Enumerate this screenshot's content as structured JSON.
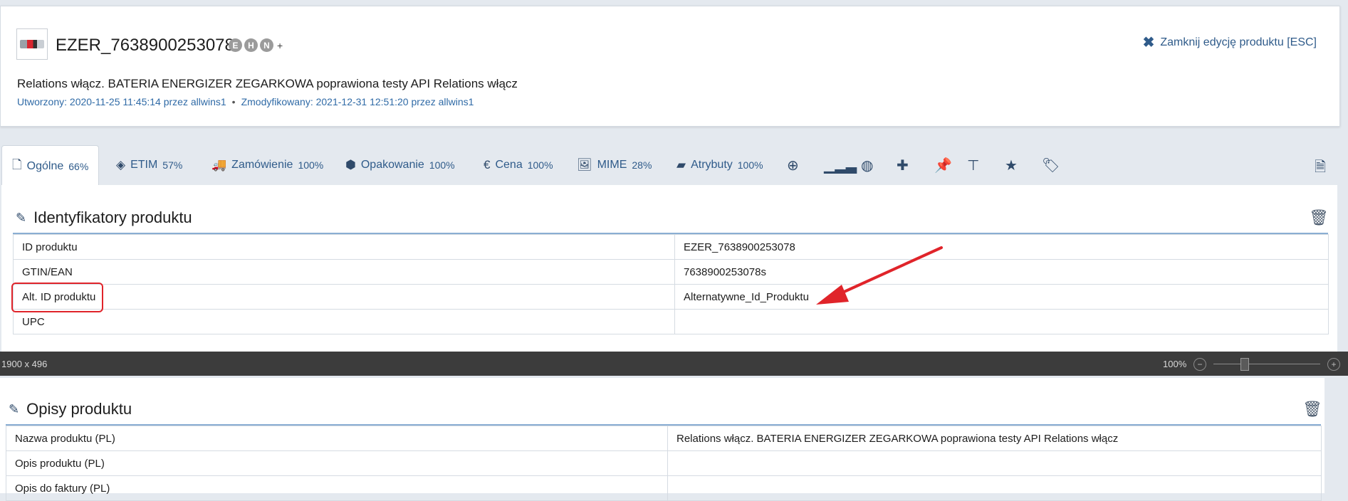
{
  "header": {
    "product_code": "EZER_7638900253078",
    "badges": [
      "E",
      "H",
      "N"
    ],
    "badge_plus": "+",
    "close_label": "Zamknij edycję produktu [ESC]",
    "product_name": "Relations włącz. BATERIA ENERGIZER ZEGARKOWA poprawiona testy API Relations włącz",
    "created": "Utworzony: 2020-11-25 11:45:14 przez allwins1",
    "modified": "Zmodyfikowany: 2021-12-31 12:51:20 przez allwins1"
  },
  "tabs": [
    {
      "label": "Ogólne",
      "pct": "66%",
      "icon": "file-icon"
    },
    {
      "label": "ETIM",
      "pct": "57%",
      "icon": "tag-diamond-icon"
    },
    {
      "label": "Zamówienie",
      "pct": "100%",
      "icon": "truck-icon"
    },
    {
      "label": "Opakowanie",
      "pct": "100%",
      "icon": "box-icon"
    },
    {
      "label": "Cena",
      "pct": "100%",
      "icon": "euro-icon"
    },
    {
      "label": "MIME",
      "pct": "28%",
      "icon": "image-icon"
    },
    {
      "label": "Atrybuty",
      "pct": "100%",
      "icon": "note-icon"
    }
  ],
  "identifiers": {
    "title": "Identyfikatory produktu",
    "rows": [
      {
        "label": "ID produktu",
        "value": "EZER_7638900253078"
      },
      {
        "label": "GTIN/EAN",
        "value": "7638900253078s"
      },
      {
        "label": "Alt. ID produktu",
        "value": "Alternatywne_Id_Produktu"
      },
      {
        "label": "UPC",
        "value": ""
      }
    ]
  },
  "statusbar": {
    "size": "1900 x 496",
    "zoom": "100%",
    "zoom_fraction": 0.29
  },
  "descriptions": {
    "title": "Opisy produktu",
    "rows": [
      {
        "label": "Nazwa produktu (PL)",
        "value": "Relations włącz. BATERIA ENERGIZER ZEGARKOWA poprawiona testy API Relations włącz"
      },
      {
        "label": "Opis produktu (PL)",
        "value": ""
      },
      {
        "label": "Opis do faktury (PL)",
        "value": ""
      }
    ]
  },
  "colors": {
    "link": "#2f5b8a",
    "highlight": "#e0242a",
    "arrow": "#e0242a"
  }
}
